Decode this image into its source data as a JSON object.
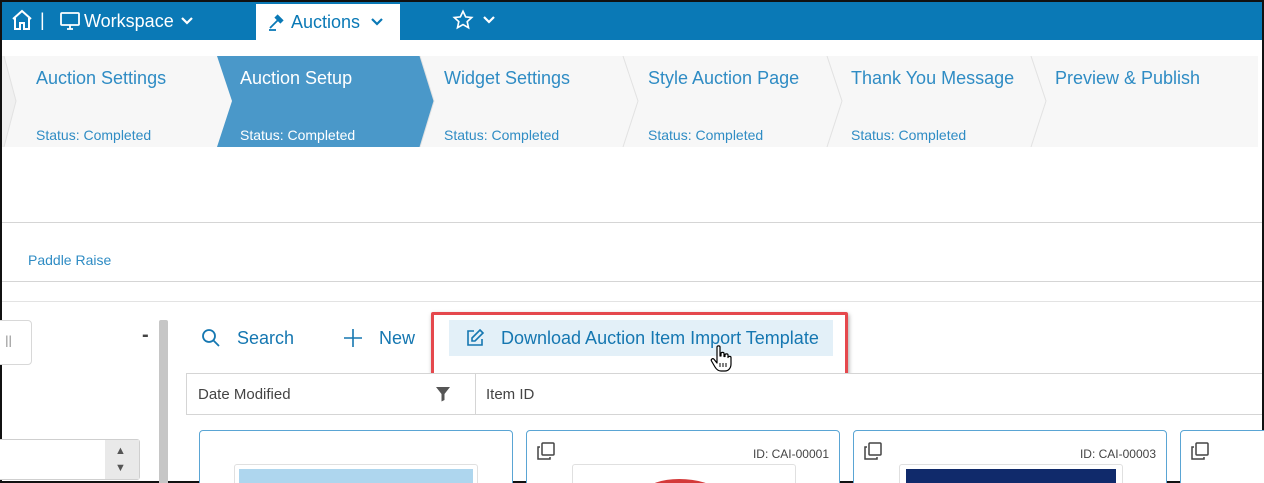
{
  "topbar": {
    "home_icon": "home-icon",
    "separator": "|",
    "workspace_label": "Workspace",
    "auctions_label": "Auctions",
    "favorites_icon": "star-icon",
    "colors": {
      "bar": "#0a79b6",
      "accent": "#2f8cc4"
    }
  },
  "steps": [
    {
      "title": "Auction Settings",
      "status": "Status: Completed",
      "active": false
    },
    {
      "title": "Auction Setup",
      "status": "Status: Completed",
      "active": true
    },
    {
      "title": "Widget Settings",
      "status": "Status: Completed",
      "active": false
    },
    {
      "title": "Style Auction Page",
      "status": "Status: Completed",
      "active": false
    },
    {
      "title": "Thank You Message",
      "status": "Status: Completed",
      "active": false
    },
    {
      "title": "Preview & Publish",
      "status": "",
      "active": false
    }
  ],
  "subtabs": {
    "paddle_raise": "Paddle Raise"
  },
  "left_panel": {
    "button_text": "ll",
    "collapse": "-"
  },
  "toolbar": {
    "search_label": "Search",
    "new_label": "New",
    "download_label": "Download Auction Item Import Template"
  },
  "grid": {
    "columns": [
      "Date Modified",
      "Item ID"
    ]
  },
  "cards": [
    {
      "id": ""
    },
    {
      "id": "ID: CAI-00001"
    },
    {
      "id": "ID: CAI-00003"
    },
    {
      "id": ""
    }
  ]
}
